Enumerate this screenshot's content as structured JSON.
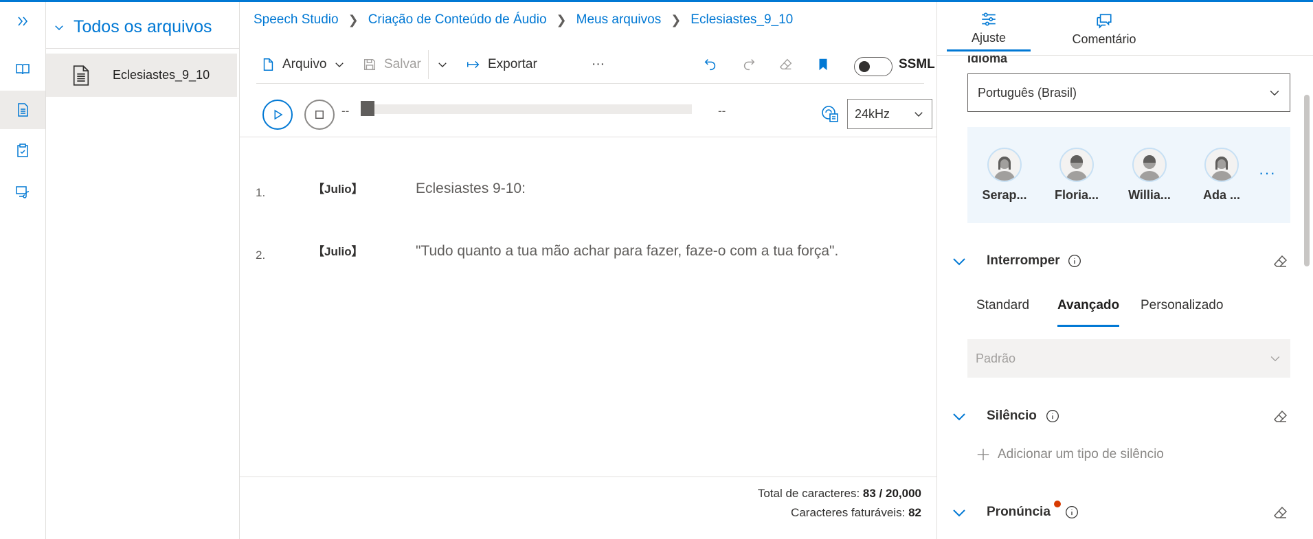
{
  "rail": {
    "items": [
      {
        "icon": "expand-icon"
      },
      {
        "icon": "book-icon"
      },
      {
        "icon": "document-icon"
      },
      {
        "icon": "clipboard-check-icon"
      },
      {
        "icon": "media-library-icon"
      }
    ]
  },
  "files": {
    "title": "Todos os arquivos",
    "items": [
      {
        "name": "Eclesiastes_9_10",
        "icon": "text-document-icon"
      }
    ]
  },
  "breadcrumb": [
    "Speech Studio",
    "Criação de Conteúdo de Áudio",
    "Meus arquivos",
    "Eclesiastes_9_10"
  ],
  "toolbar": {
    "file_label": "Arquivo",
    "save_label": "Salvar",
    "export_label": "Exportar",
    "more_label": "···",
    "ssml_label": "SSML",
    "ssml_enabled": false
  },
  "player": {
    "current_time": "--",
    "total_time": "--",
    "sample_rate": "24kHz"
  },
  "content": {
    "lines": [
      {
        "number": "1.",
        "voice": "【Julio】",
        "text": "Eclesiastes 9-10:"
      },
      {
        "number": "2.",
        "voice": "【Julio】",
        "text": "\"Tudo quanto a tua mão achar para fazer, faze-o com a tua força\"."
      }
    ]
  },
  "footer": {
    "total_label": "Total de caracteres:",
    "total_value": "83 / 20,000",
    "billable_label": "Caracteres faturáveis:",
    "billable_value": "82"
  },
  "panel": {
    "tabs": [
      {
        "label": "Ajuste",
        "icon": "sliders-icon",
        "active": true
      },
      {
        "label": "Comentário",
        "icon": "comment-icon",
        "active": false
      }
    ],
    "language_label": "Idioma",
    "language_value": "Português (Brasil)",
    "voices": [
      "Serap...",
      "Floria...",
      "Willia...",
      "Ada ..."
    ],
    "voices_more": "···",
    "break_section": {
      "title": "Interromper",
      "tabs": [
        "Standard",
        "Avançado",
        "Personalizado"
      ],
      "active_tab": "Avançado",
      "select_placeholder": "Padrão"
    },
    "silence_section": {
      "title": "Silêncio",
      "add_label": "Adicionar um tipo de silêncio"
    },
    "pronunciation_section": {
      "title": "Pronúncia"
    }
  },
  "colors": {
    "accent": "#0078d4",
    "notification_dot": "#d83b01",
    "voice_panel_bg": "#eff6fc"
  }
}
